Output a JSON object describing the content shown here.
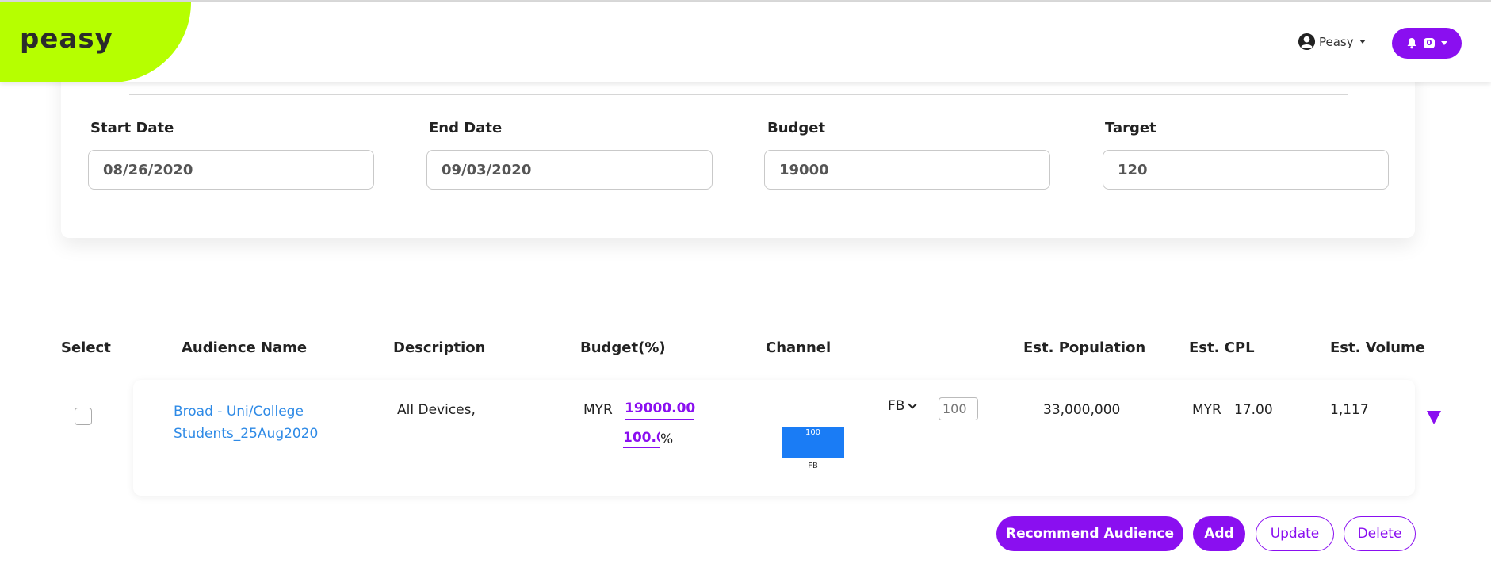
{
  "header": {
    "logo": "peasy",
    "user_name": "Peasy",
    "notification_count": "0",
    "accent_color": "#8a0ff0",
    "logo_color": "#b6ff00"
  },
  "form": {
    "start_date": {
      "label": "Start Date",
      "value": "08/26/2020"
    },
    "end_date": {
      "label": "End Date",
      "value": "09/03/2020"
    },
    "budget": {
      "label": "Budget",
      "value": "19000"
    },
    "target": {
      "label": "Target",
      "value": "120"
    }
  },
  "table": {
    "headers": {
      "select": "Select",
      "audience_name": "Audience Name",
      "description": "Description",
      "budget_pct": "Budget(%)",
      "channel": "Channel",
      "est_population": "Est. Population",
      "est_cpl": "Est. CPL",
      "est_volume": "Est. Volume"
    },
    "rows": [
      {
        "audience_name": "Broad - Uni/College Students_25Aug2020",
        "description": "All Devices,",
        "budget_currency": "MYR",
        "budget_amount": "19000.00",
        "budget_percent": "100.0",
        "percent_sign": "%",
        "channel_chart": {
          "type": "bar",
          "categories": [
            "FB"
          ],
          "values": [
            100
          ],
          "label": "100"
        },
        "channel": "FB",
        "channel_percent": "100",
        "est_population": "33,000,000",
        "cpl_currency": "MYR",
        "est_cpl": "17.00",
        "est_volume": "1,117"
      }
    ]
  },
  "buttons": {
    "recommend": "Recommend Audience",
    "add": "Add",
    "update": "Update",
    "delete": "Delete"
  }
}
